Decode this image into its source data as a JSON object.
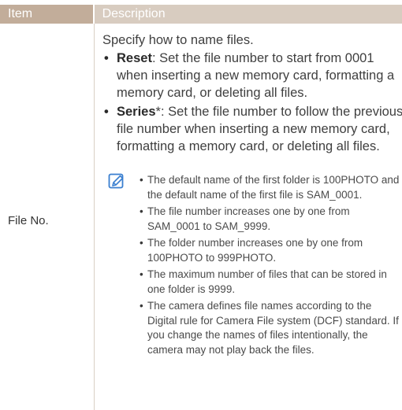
{
  "table": {
    "header_item": "Item",
    "header_description": "Description",
    "item_label": "File No.",
    "intro": "Specify how to name files.",
    "options": [
      {
        "name": "Reset",
        "suffix": "",
        "text": ": Set the file number to start from 0001 when inserting a new memory card, formatting a memory card, or deleting all files."
      },
      {
        "name": "Series",
        "suffix": "*",
        "text": ": Set the file number to follow the previous file number when inserting a new memory card, formatting a memory card, or deleting all files."
      }
    ],
    "note_icon": "note-pencil-icon",
    "notes": [
      "The default name of the first folder is 100PHOTO and the default name of the first file is SAM_0001.",
      "The file number increases one by one from SAM_0001 to SAM_9999.",
      "The folder number increases one by one from 100PHOTO to 999PHOTO.",
      "The maximum number of files that can be stored in one folder is 9999.",
      "The camera defines file names according to the Digital rule for Camera File system (DCF) standard. If you change the names of files intentionally, the camera may not play back the files."
    ]
  },
  "colors": {
    "header_item_bg": "#c2ad9a",
    "header_desc_bg": "#d8ccc0",
    "divider": "#d9cfc5",
    "note_icon": "#3a7fd0"
  }
}
